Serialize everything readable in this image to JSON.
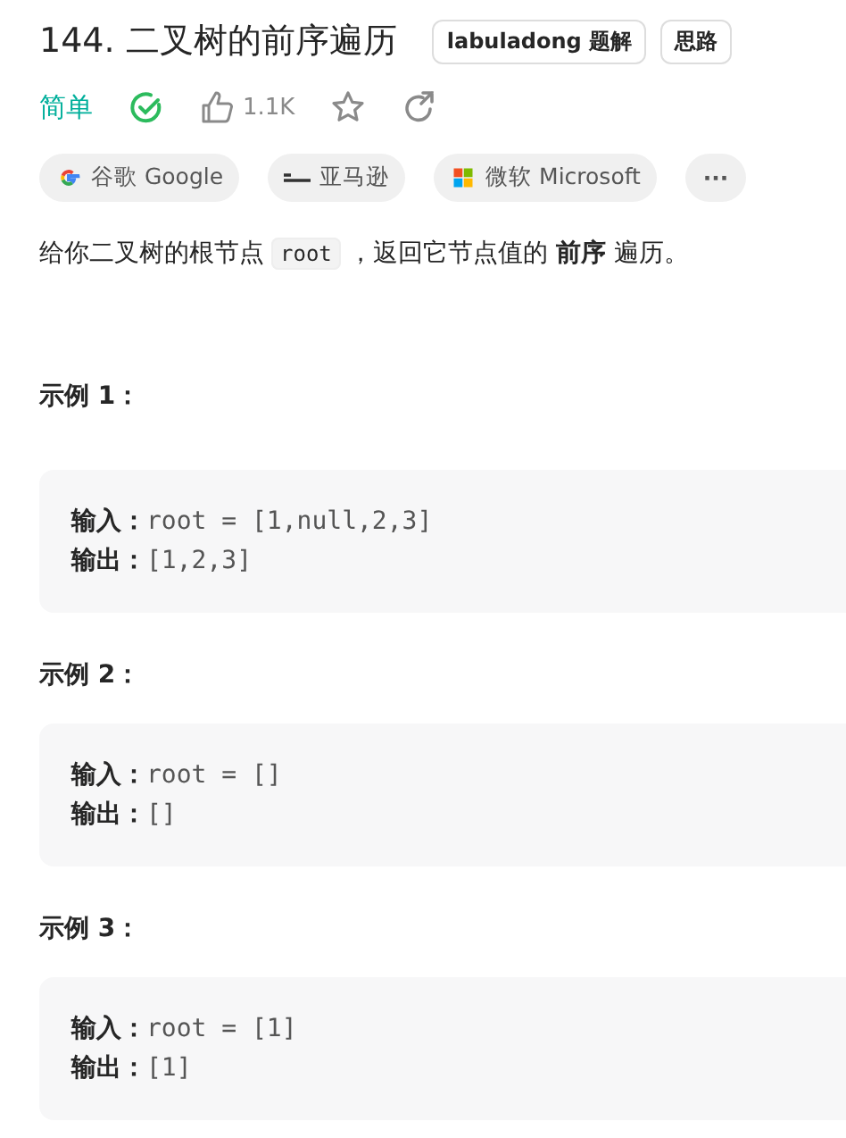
{
  "title": "144. 二叉树的前序遍历",
  "tags": [
    {
      "label": "labuladong 题解"
    },
    {
      "label": "思路"
    }
  ],
  "meta": {
    "difficulty": "简单",
    "solved": true,
    "likes": "1.1K"
  },
  "companies": [
    {
      "kind": "google",
      "label": "谷歌 Google"
    },
    {
      "kind": "amazon",
      "label": "亚马逊"
    },
    {
      "kind": "microsoft",
      "label": "微软 Microsoft"
    },
    {
      "kind": "more",
      "label": "···"
    }
  ],
  "description": {
    "before": "给你二叉树的根节点",
    "code": "root",
    "after": "，返回它节点值的 **前序** 遍历。"
  },
  "examples": [
    {
      "heading": "示例 1：",
      "lines": [
        "**输入：**root = [1,null,2,3]",
        "**输出：**[1,2,3]"
      ]
    },
    {
      "heading": "示例 2：",
      "lines": [
        "**输入：**root = []",
        "**输出：**[]"
      ]
    },
    {
      "heading": "示例 3：",
      "lines": [
        "**输入：**root = [1]",
        "**输出：**[1]"
      ]
    }
  ]
}
